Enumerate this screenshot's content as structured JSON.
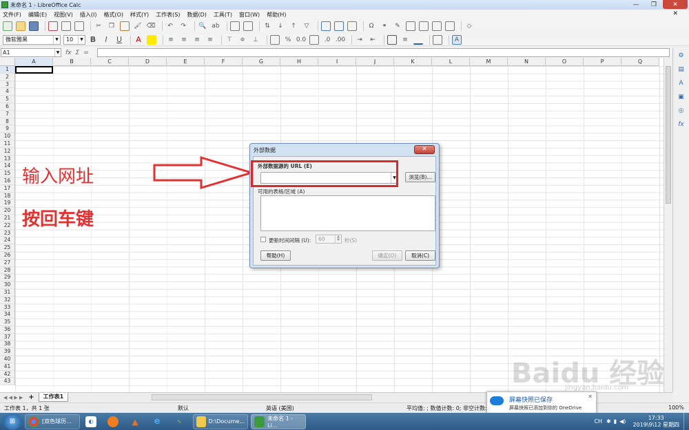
{
  "window": {
    "title": "未命名 1 - LibreOffice Calc",
    "min": "—",
    "max": "❐",
    "close": "✕"
  },
  "menu": [
    "文件(F)",
    "编辑(E)",
    "视图(V)",
    "插入(I)",
    "格式(O)",
    "样式(Y)",
    "工作表(S)",
    "数据(D)",
    "工具(T)",
    "窗口(W)",
    "帮助(H)"
  ],
  "menu_close": "✕",
  "format": {
    "font_name": "微软雅黑",
    "font_size": "10"
  },
  "formula": {
    "cell_ref": "A1",
    "fx": "fx",
    "sigma": "Σ",
    "equals": "="
  },
  "columns": [
    "A",
    "B",
    "C",
    "D",
    "E",
    "F",
    "G",
    "H",
    "I",
    "J",
    "K",
    "L",
    "M",
    "N",
    "O",
    "P",
    "Q"
  ],
  "rows": [
    "1",
    "2",
    "3",
    "4",
    "5",
    "6",
    "7",
    "8",
    "9",
    "10",
    "11",
    "12",
    "13",
    "14",
    "15",
    "16",
    "17",
    "18",
    "19",
    "20",
    "21",
    "22",
    "23",
    "24",
    "25",
    "26",
    "27",
    "28",
    "29",
    "30",
    "31",
    "32",
    "33",
    "34",
    "35",
    "36",
    "37",
    "38",
    "39",
    "40",
    "41",
    "42",
    "43"
  ],
  "sheet": {
    "add": "+",
    "tab_name": "工作表1",
    "nav": "◀ ◀ ▶ ▶"
  },
  "status": {
    "sheet_info": "工作表 1，共 1 张",
    "page_style": "默认",
    "language": "英语 (美国)",
    "summary": "平均值: ; 数值计数: 0; 非空计数: 0",
    "zoom": "100%"
  },
  "annotation": {
    "line1": "输入网址",
    "line2": "按回车键"
  },
  "dialog": {
    "title": "外部数据",
    "close": "✕",
    "url_label": "外部数据源的 URL (E)",
    "browse": "浏览(B)...",
    "tables_label": "可用的表格/区域 (A)",
    "update_label": "更新时间间隔 (U):",
    "update_value": "60",
    "seconds": "秒(S)",
    "help": "帮助(H)",
    "ok": "确定(O)",
    "cancel": "取消(C)"
  },
  "toast": {
    "title": "屏幕快照已保存",
    "subtitle": "屏幕快照已添加到你的 OneDrive",
    "close": "✕"
  },
  "taskbar": {
    "items": [
      "[双色球历...",
      "D:\\Docume...",
      "未命名 1 - Li..."
    ],
    "clock_time": "17:33",
    "clock_date": "2019\\9\\12 星期四",
    "ime": "CH"
  },
  "watermark": {
    "main": "Baidu 经验",
    "sub": "jingyan.baidu.com"
  }
}
